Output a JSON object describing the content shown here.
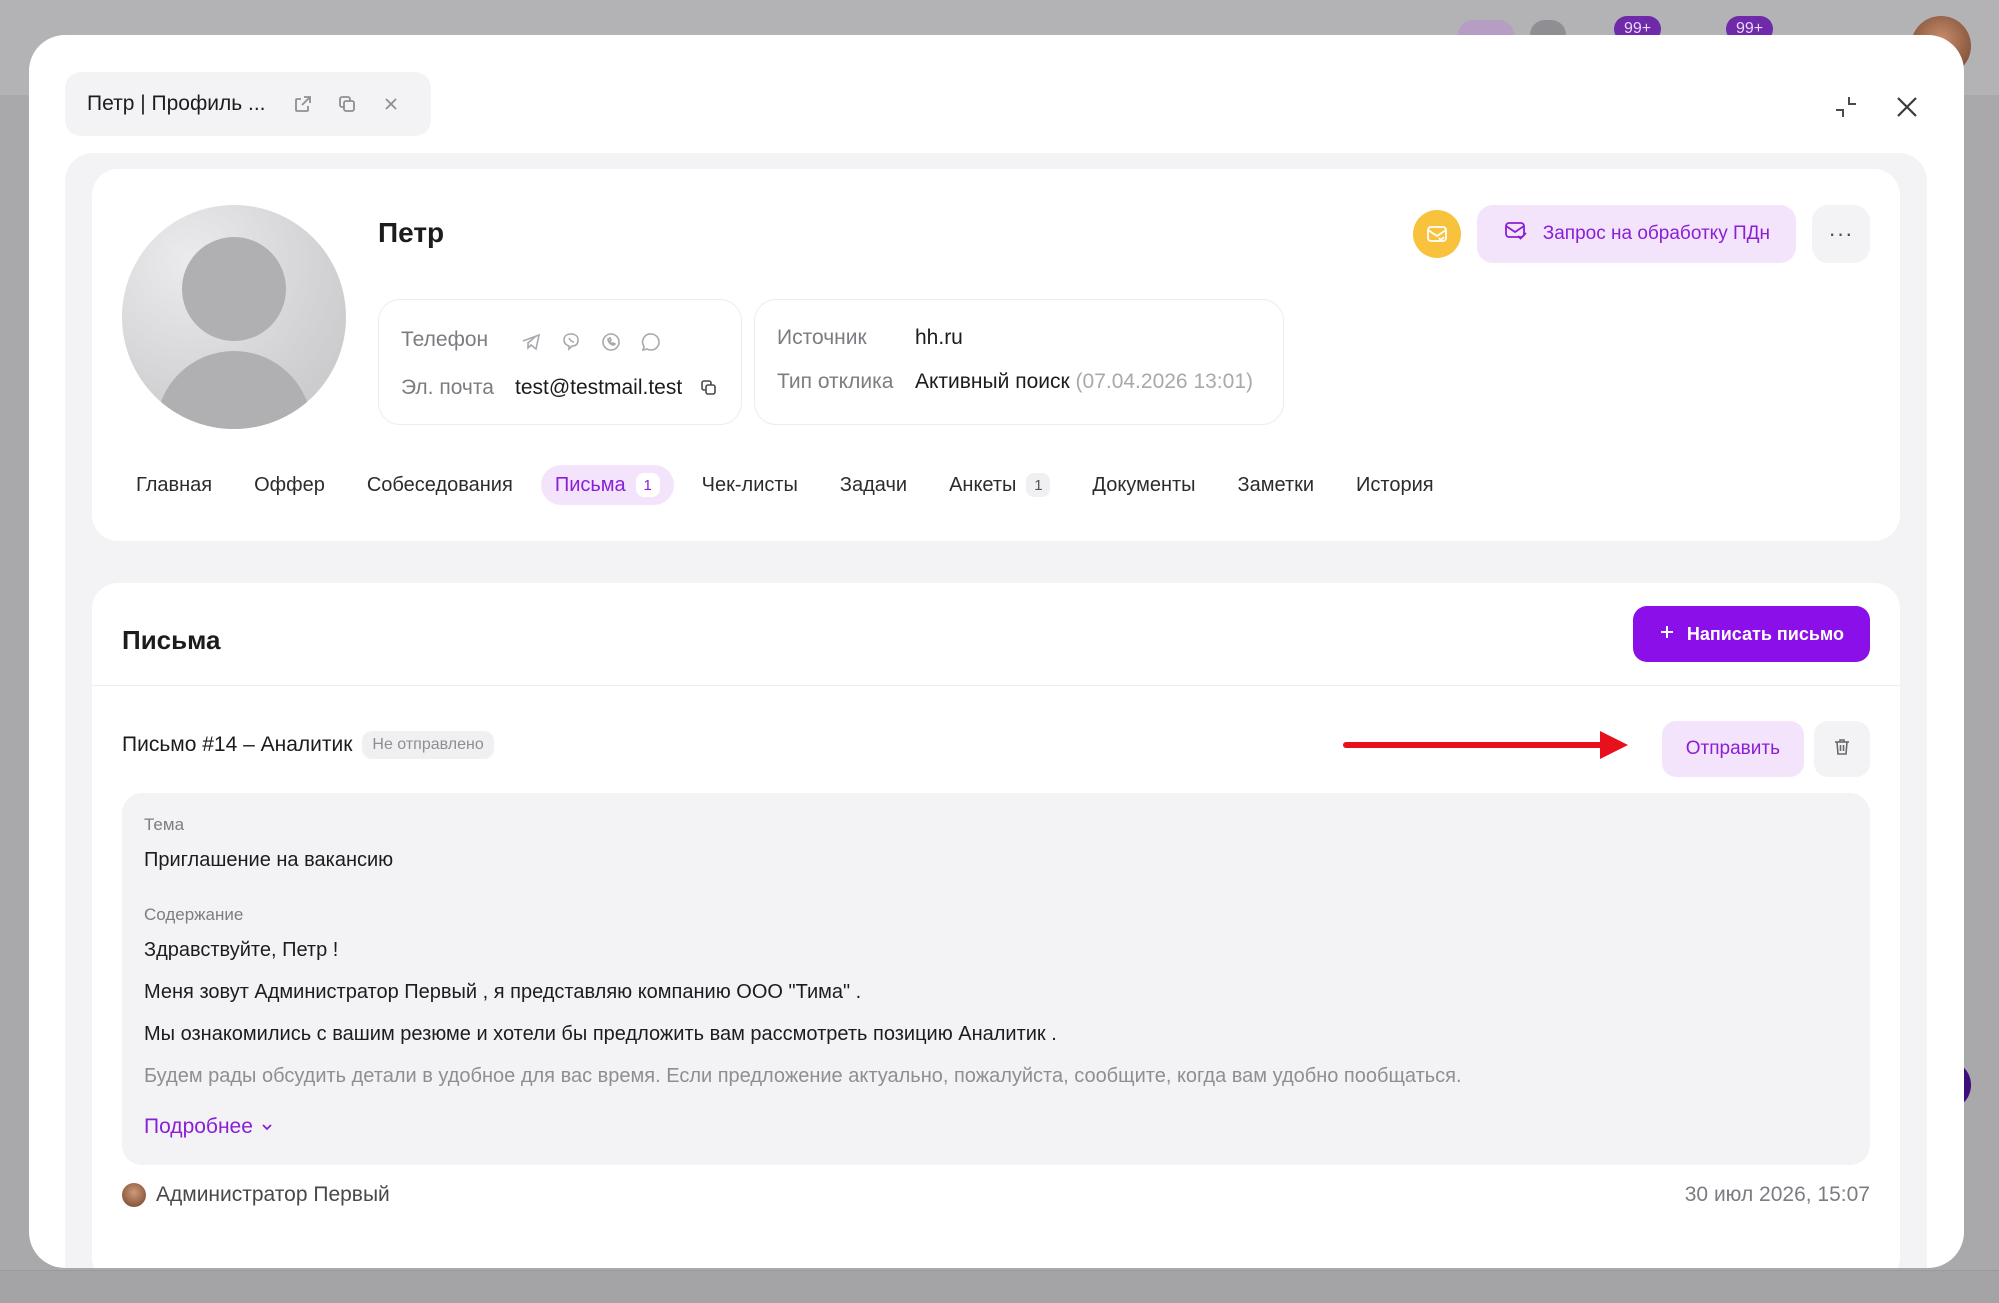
{
  "background": {
    "badges": [
      "99+",
      "99+"
    ]
  },
  "modal_tab": {
    "title": "Петр | Профиль ..."
  },
  "candidate": {
    "name": "Петр",
    "phone_label": "Телефон",
    "email_label": "Эл. почта",
    "email": "test@testmail.test",
    "source_label": "Источник",
    "source": "hh.ru",
    "response_type_label": "Тип отклика",
    "response_type": "Активный поиск",
    "response_date": "(07.04.2026 13:01)"
  },
  "actions": {
    "pd_request_label": "Запрос на обработку ПДн",
    "more_label": "···"
  },
  "tabs": [
    {
      "label": "Главная",
      "count": ""
    },
    {
      "label": "Оффер",
      "count": ""
    },
    {
      "label": "Собеседования",
      "count": ""
    },
    {
      "label": "Письма",
      "count": "1",
      "active": true
    },
    {
      "label": "Чек-листы",
      "count": ""
    },
    {
      "label": "Задачи",
      "count": ""
    },
    {
      "label": "Анкеты",
      "count": "1"
    },
    {
      "label": "Документы",
      "count": ""
    },
    {
      "label": "Заметки",
      "count": ""
    },
    {
      "label": "История",
      "count": ""
    }
  ],
  "letters": {
    "title": "Письма",
    "write_button": "Написать письмо",
    "item": {
      "title": "Письмо #14 – Аналитик",
      "status": "Не отправлено",
      "send_button": "Отправить",
      "subject_label": "Тема",
      "subject": "Приглашение на вакансию",
      "content_label": "Содержание",
      "lines": [
        "Здравствуйте, Петр !",
        "Меня зовут Администратор Первый , я представляю компанию ООО \"Тима\" .",
        "Мы ознакомились с вашим резюме и хотели бы предложить вам рассмотреть позицию Аналитик .",
        "Будем рады обсудить детали в удобное для вас время. Если предложение актуально, пожалуйста, сообщите, когда вам удобно пообщаться."
      ],
      "more_link": "Подробнее",
      "author": "Администратор Первый",
      "date": "30 июл 2026, 15:07"
    }
  },
  "colors": {
    "accent": "#8a0fe8",
    "accent_light": "#f3e4fb",
    "warning": "#f9c23c",
    "annotation_arrow": "#e8101a"
  }
}
